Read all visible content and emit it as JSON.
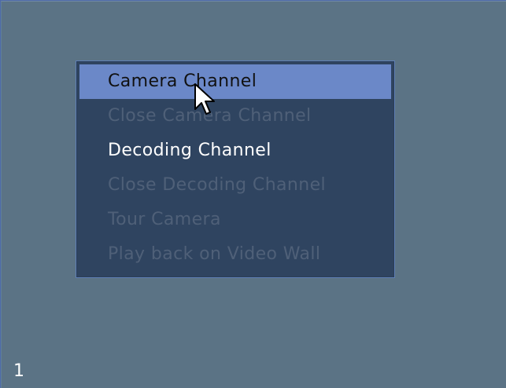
{
  "video_window": {
    "number": "1"
  },
  "context_menu": {
    "items": [
      {
        "label": "Camera Channel",
        "state": "selected"
      },
      {
        "label": "Close Camera Channel",
        "state": "disabled"
      },
      {
        "label": "Decoding Channel",
        "state": "enabled"
      },
      {
        "label": "Close Decoding Channel",
        "state": "disabled"
      },
      {
        "label": "Tour Camera",
        "state": "disabled"
      },
      {
        "label": "Play back on Video Wall",
        "state": "disabled"
      }
    ]
  },
  "colors": {
    "background": "#5b7385",
    "menu_background": "#2f4460",
    "menu_border": "#5e7fb5",
    "selected_item": "#6b88c8",
    "enabled_text": "#ffffff",
    "disabled_text": "#4f6078"
  },
  "icons": {
    "cursor": "mouse-pointer-icon"
  }
}
